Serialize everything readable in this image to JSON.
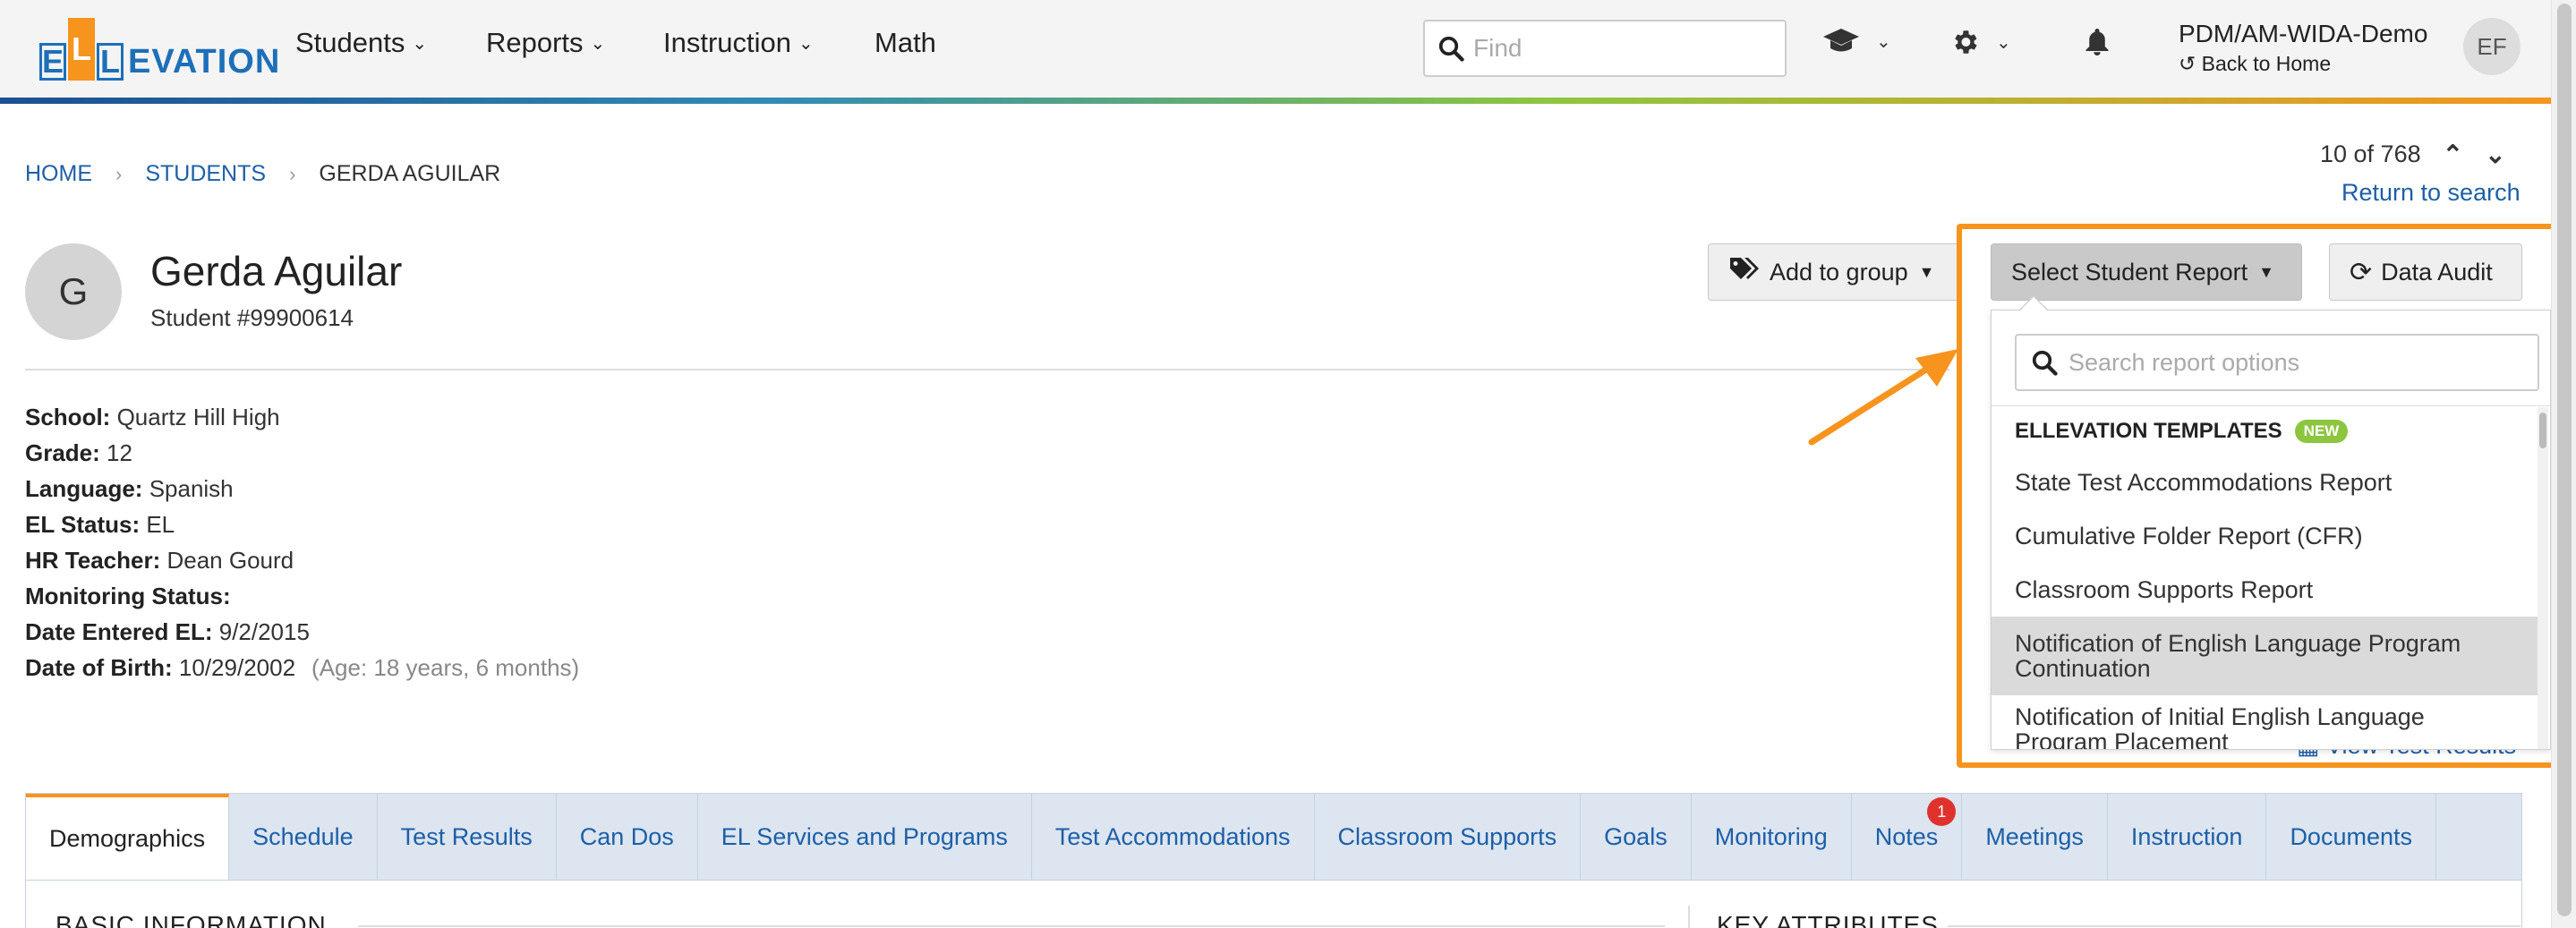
{
  "navbar": {
    "logo": {
      "letters": [
        "E",
        "L",
        "L"
      ],
      "text": "EVATION"
    },
    "menu": [
      {
        "label": "Students",
        "has_dropdown": true
      },
      {
        "label": "Reports",
        "has_dropdown": true
      },
      {
        "label": "Instruction",
        "has_dropdown": true
      },
      {
        "label": "Math",
        "has_dropdown": false
      }
    ],
    "search_placeholder": "Find",
    "org_name": "PDM/AM-WIDA-Demo",
    "back_home": "Back to Home",
    "user_initials": "EF",
    "icons": [
      "graduation-cap-icon",
      "gear-icon",
      "bell-icon"
    ]
  },
  "breadcrumb": {
    "home": "HOME",
    "students": "STUDENTS",
    "current": "GERDA AGUILAR"
  },
  "pager": {
    "text": "10 of 768",
    "return_label": "Return to search"
  },
  "student": {
    "initial": "G",
    "name": "Gerda Aguilar",
    "id_text": "Student #99900614",
    "fields": [
      {
        "label": "School:",
        "value": "Quartz Hill High"
      },
      {
        "label": "Grade:",
        "value": "12"
      },
      {
        "label": "Language:",
        "value": "Spanish"
      },
      {
        "label": "EL Status:",
        "value": "EL"
      },
      {
        "label": "HR Teacher:",
        "value": "Dean Gourd"
      },
      {
        "label": "Monitoring Status:",
        "value": ""
      },
      {
        "label": "Date Entered EL:",
        "value": "9/2/2015"
      },
      {
        "label": "Date of Birth:",
        "value": "10/29/2002",
        "extra": "(Age: 18 years, 6 months)"
      }
    ]
  },
  "actions": {
    "add_to_group": "Add to group",
    "select_report": "Select Student Report",
    "data_audit": "Data Audit"
  },
  "report_dropdown": {
    "search_placeholder": "Search report options",
    "section_header": "ELLEVATION TEMPLATES",
    "new_badge": "NEW",
    "items": [
      {
        "line1": "State Test Accommodations Report",
        "line2": ""
      },
      {
        "line1": "Cumulative Folder Report (CFR)",
        "line2": ""
      },
      {
        "line1": "Classroom Supports Report",
        "line2": ""
      },
      {
        "line1": "Notification of English Language Program",
        "line2": "Continuation",
        "highlighted": true
      },
      {
        "line1": "Notification of Initial English Language",
        "line2": "Program Placement"
      }
    ]
  },
  "view_test_results": "View Test Results",
  "tabs": [
    {
      "label": "Demographics",
      "active": true
    },
    {
      "label": "Schedule"
    },
    {
      "label": "Test Results"
    },
    {
      "label": "Can Dos"
    },
    {
      "label": "EL Services and Programs"
    },
    {
      "label": "Test Accommodations"
    },
    {
      "label": "Classroom Supports"
    },
    {
      "label": "Goals"
    },
    {
      "label": "Monitoring"
    },
    {
      "label": "Notes",
      "badge": "1"
    },
    {
      "label": "Meetings"
    },
    {
      "label": "Instruction"
    },
    {
      "label": "Documents"
    }
  ],
  "sections": {
    "basic_info": "BASIC INFORMATION",
    "key_attributes": "KEY ATTRIBUTES"
  },
  "colors": {
    "accent_orange": "#f7941d",
    "link_blue": "#1d5fa8",
    "logo_blue": "#1d6fb8",
    "new_green": "#8cc63f",
    "badge_red": "#e0322d"
  }
}
